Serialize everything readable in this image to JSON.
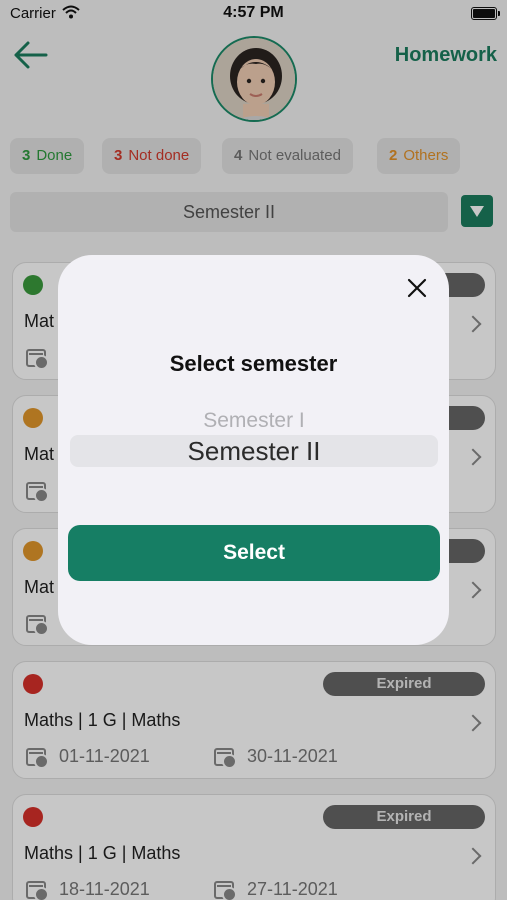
{
  "status_bar": {
    "carrier": "Carrier",
    "time": "4:57 PM"
  },
  "header": {
    "title": "Homework",
    "back_icon": "arrow-left-icon"
  },
  "filters": [
    {
      "count": "3",
      "label": "Done",
      "color": "#2f9a3f"
    },
    {
      "count": "3",
      "label": "Not done",
      "color": "#d33a2c"
    },
    {
      "count": "4",
      "label": "Not evaluated",
      "color": "#777777"
    },
    {
      "count": "2",
      "label": "Others",
      "color": "#e3932a"
    }
  ],
  "semester_selector": {
    "value": "Semester II"
  },
  "cards": [
    {
      "status_color": "#3a9a3d",
      "badge": "",
      "subject": "Mat",
      "start_date": "",
      "end_date": ""
    },
    {
      "status_color": "#e0962b",
      "badge": "",
      "subject": "Mat",
      "start_date": "",
      "end_date": ""
    },
    {
      "status_color": "#e0962b",
      "badge": "",
      "subject": "Mat",
      "start_date": "",
      "end_date": ""
    },
    {
      "status_color": "#d6302a",
      "badge": "Expired",
      "subject": "Maths | 1 G | Maths",
      "start_date": "01-11-2021",
      "end_date": "30-11-2021"
    },
    {
      "status_color": "#d6302a",
      "badge": "Expired",
      "subject": "Maths | 1 G | Maths",
      "start_date": "18-11-2021",
      "end_date": "27-11-2021"
    }
  ],
  "modal": {
    "title": "Select semester",
    "options": [
      "Semester I",
      "Semester II"
    ],
    "selected": "Semester II",
    "button_label": "Select",
    "close_icon": "close-icon"
  },
  "colors": {
    "accent": "#1b7d5e",
    "button": "#167e64",
    "badge": "#666666"
  }
}
